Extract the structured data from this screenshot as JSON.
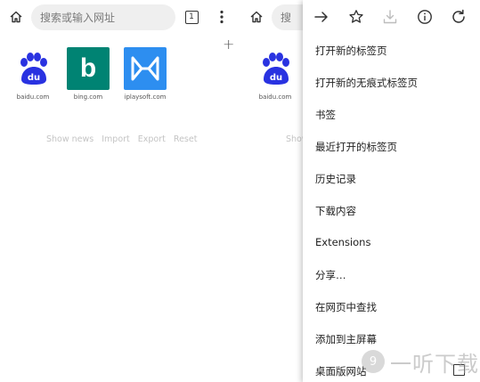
{
  "left": {
    "search_placeholder": "搜索或输入网址",
    "tab_count": "1",
    "tiles": [
      {
        "label": "baidu.com",
        "logo_text": "du",
        "color": "#2932e1",
        "icon": "baidu-paw-icon"
      },
      {
        "label": "bing.com",
        "logo_text": "b",
        "color": "#008373",
        "icon": "bing-logo-icon"
      },
      {
        "label": "iplaysoft.com",
        "logo_text": "",
        "color": "#2d8ef0",
        "icon": "iplaysoft-logo-icon"
      }
    ],
    "links": [
      "Show news",
      "Import",
      "Export",
      "Reset"
    ]
  },
  "right": {
    "search_placeholder": "搜",
    "tiles": [
      {
        "label": "baidu.com",
        "logo_text": "du",
        "color": "#2932e1",
        "icon": "baidu-paw-icon"
      }
    ],
    "links_partial": "Show"
  },
  "menu": {
    "toolbar_icons": [
      "forward-arrow-icon",
      "bookmark-star-icon",
      "download-icon",
      "info-icon",
      "reload-icon"
    ],
    "items": [
      "打开新的标签页",
      "打开新的无痕式标签页",
      "书签",
      "最近打开的标签页",
      "历史记录",
      "下载内容",
      "Extensions",
      "分享…",
      "在网页中查找",
      "添加到主屏幕",
      "桌面版网站"
    ]
  },
  "watermark": {
    "logo_text": "9",
    "text": "一听下载"
  }
}
